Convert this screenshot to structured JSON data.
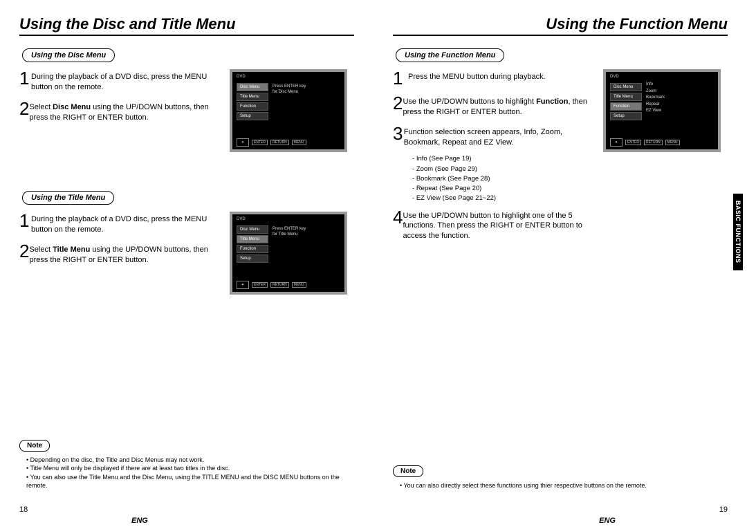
{
  "left": {
    "title": "Using the Disc and Title Menu",
    "section1": {
      "pill": "Using the Disc Menu",
      "step1": "During the playback of a DVD disc, press the MENU button on the remote.",
      "step2_pre": "Select ",
      "step2_bold": "Disc Menu",
      "step2_post": " using the UP/DOWN buttons, then press the RIGHT or ENTER button.",
      "screen": {
        "dvd": "DVD",
        "items": [
          "Disc Menu",
          "Title Menu",
          "Function",
          "Setup"
        ],
        "hint1": "Press ENTER key",
        "hint2": "for Disc Menu",
        "btns": [
          "ENTER",
          "RETURN",
          "MENU"
        ]
      }
    },
    "section2": {
      "pill": "Using the Title Menu",
      "step1": "During the playback of a DVD disc, press the MENU button on the remote.",
      "step2_pre": "Select ",
      "step2_bold": "Title Menu",
      "step2_post": " using the UP/DOWN buttons, then press the RIGHT or ENTER button.",
      "screen": {
        "dvd": "DVD",
        "items": [
          "Disc Menu",
          "Title Menu",
          "Function",
          "Setup"
        ],
        "hint1": "Press ENTER key",
        "hint2": "for Title Menu",
        "btns": [
          "ENTER",
          "RETURN",
          "MENU"
        ]
      }
    },
    "note": {
      "label": "Note",
      "items": [
        "Depending on the disc, the Title and Disc Menus may not work.",
        "Title Menu will only be displayed if there are at least two titles in the disc.",
        "You can also use the Title Menu and the Disc Menu, using the TITLE MENU and the DISC MENU buttons on the remote."
      ]
    },
    "pageNum": "18",
    "lang": "ENG"
  },
  "right": {
    "title": "Using the Function Menu",
    "section": {
      "pill": "Using the Function Menu",
      "step1": "Press the MENU button during playback.",
      "step2_pre": "Use the UP/DOWN buttons to highlight ",
      "step2_bold": "Function",
      "step2_post": ", then press the RIGHT or ENTER button.",
      "step3": "Function selection screen appears, Info, Zoom, Bookmark, Repeat and EZ View.",
      "sublist": [
        "Info (See Page 19)",
        "Zoom (See Page 29)",
        "Bookmark (See Page 28)",
        "Repeat (See Page 20)",
        "EZ View (See Page 21~22)"
      ],
      "step4": "Use the UP/DOWN button to highlight one of the 5 functions. Then press the RIGHT or ENTER button to access the function.",
      "screen": {
        "dvd": "DVD",
        "items": [
          "Disc Menu",
          "Title Menu",
          "Function",
          "Setup"
        ],
        "funcs": [
          "Info",
          "Zoom",
          "Bookmark",
          "Repeat",
          "EZ View"
        ],
        "btns": [
          "ENTER",
          "RETURN",
          "MENU"
        ]
      }
    },
    "note": {
      "label": "Note",
      "items": [
        "You can also directly select these functions using thier respective buttons on the remote."
      ]
    },
    "sideTab": "BASIC FUNCTIONS",
    "pageNum": "19",
    "lang": "ENG"
  }
}
